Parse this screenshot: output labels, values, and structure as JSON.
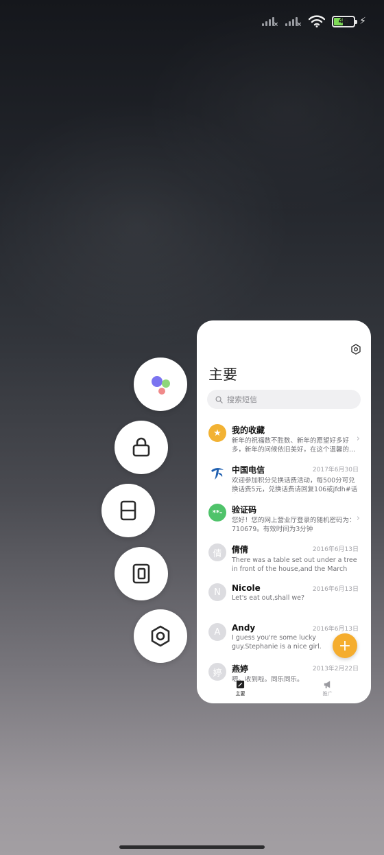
{
  "status_bar": {
    "battery_level": "46",
    "signal_x": "×"
  },
  "panel": {
    "title": "主要",
    "search_placeholder": "搜索短信",
    "messages": [
      {
        "name": "我的收藏",
        "date": "",
        "snippet": "新年的祝福数不胜数、新年的愿望好多好多，新年的问候依旧美好，在这个温馨的...",
        "avatar": "★",
        "avatar_color": "#f2b233",
        "chevron": true
      },
      {
        "name": "中国电信",
        "date": "2017年6月30日",
        "snippet": "欢迎参加积分兑换话费活动，每500分可兑换话费5元，兑换话费请回复106或jfdh#话费...",
        "avatar": "telecom-logo",
        "avatar_color": "#ffffff",
        "chevron": false
      },
      {
        "name": "验证码",
        "date": "",
        "snippet": "您好！您的网上营业厅登录的随机密码为：710679。有效时间为3分钟",
        "avatar": "**-",
        "avatar_color": "#4fc36a",
        "chevron": true
      },
      {
        "name": "倩倩",
        "date": "2016年6月13日",
        "snippet": "There was a table set out under a tree in front of the house,and the March Hare an...",
        "avatar": "倩",
        "avatar_color": "#dcdce0",
        "chevron": false
      },
      {
        "name": "Nicole",
        "date": "2016年6月13日",
        "snippet": "Let's eat out,shall we?",
        "avatar": "N",
        "avatar_color": "#dcdce0",
        "chevron": false
      },
      {
        "name": "Andy",
        "date": "2016年6月13日",
        "snippet": "I guess you're some lucky guy.Stephanie is a nice girl.",
        "avatar": "A",
        "avatar_color": "#dcdce0",
        "chevron": false
      },
      {
        "name": "燕婷",
        "date": "2013年2月22日",
        "snippet": "嗯。收到啦。同乐同乐。",
        "avatar": "婷",
        "avatar_color": "#dcdce0",
        "chevron": false
      }
    ],
    "fab_label": "+",
    "nav": [
      {
        "label": "主要",
        "icon": "compose-icon",
        "active": true
      },
      {
        "label": "推广",
        "icon": "megaphone-icon",
        "active": false
      }
    ]
  },
  "quick_buttons": [
    {
      "name": "assistant-button",
      "icon": "assistant-dots-icon"
    },
    {
      "name": "lock-button",
      "icon": "lock-icon"
    },
    {
      "name": "split-screen-button",
      "icon": "split-screen-icon"
    },
    {
      "name": "floating-window-button",
      "icon": "floating-window-icon"
    },
    {
      "name": "settings-button",
      "icon": "hexagon-settings-icon"
    }
  ],
  "colors": {
    "accent": "#f5ad2e",
    "panel_bg": "#ffffff"
  }
}
